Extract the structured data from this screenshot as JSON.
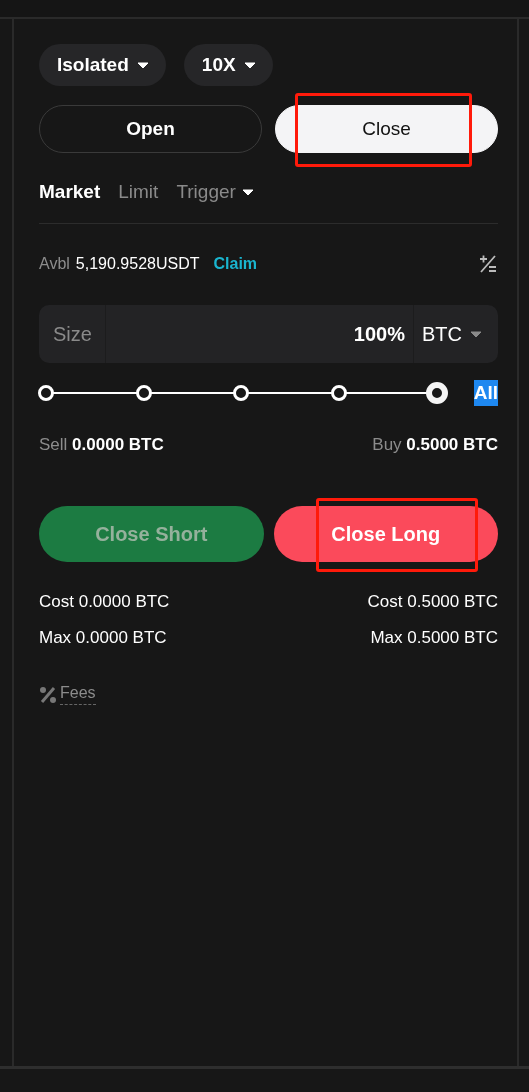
{
  "margin_chips": [
    {
      "label": "Isolated"
    },
    {
      "label": "10X"
    }
  ],
  "mode_tabs": [
    {
      "label": "Open",
      "selected": false,
      "highlighted": false
    },
    {
      "label": "Close",
      "selected": true,
      "highlighted": true
    }
  ],
  "order_types": [
    {
      "label": "Market",
      "selected": true,
      "has_menu": false
    },
    {
      "label": "Limit",
      "selected": false,
      "has_menu": false
    },
    {
      "label": "Trigger",
      "selected": false,
      "has_menu": true
    }
  ],
  "available": {
    "label": "Avbl",
    "value": "5,190.9528USDT",
    "link": "Claim"
  },
  "size_field": {
    "placeholder": "Size",
    "value": "100%",
    "unit": "BTC"
  },
  "slider": {
    "level": 1,
    "all_label": "All"
  },
  "sell_buy": [
    {
      "label": "Sell",
      "value": "0.0000 BTC"
    },
    {
      "label": "Buy",
      "value": "0.5000 BTC"
    }
  ],
  "actions": [
    {
      "label": "Close Short",
      "kind": "short",
      "disabled": true,
      "highlighted": false
    },
    {
      "label": "Close Long",
      "kind": "long",
      "disabled": false,
      "highlighted": true
    }
  ],
  "summary": [
    {
      "left": {
        "label": "Cost",
        "value": "0.0000 BTC"
      },
      "right": {
        "label": "Cost",
        "value": "0.5000 BTC"
      }
    },
    {
      "left": {
        "label": "Max",
        "value": "0.0000 BTC"
      },
      "right": {
        "label": "Max",
        "value": "0.5000 BTC"
      }
    }
  ],
  "fees": {
    "label": "Fees"
  }
}
